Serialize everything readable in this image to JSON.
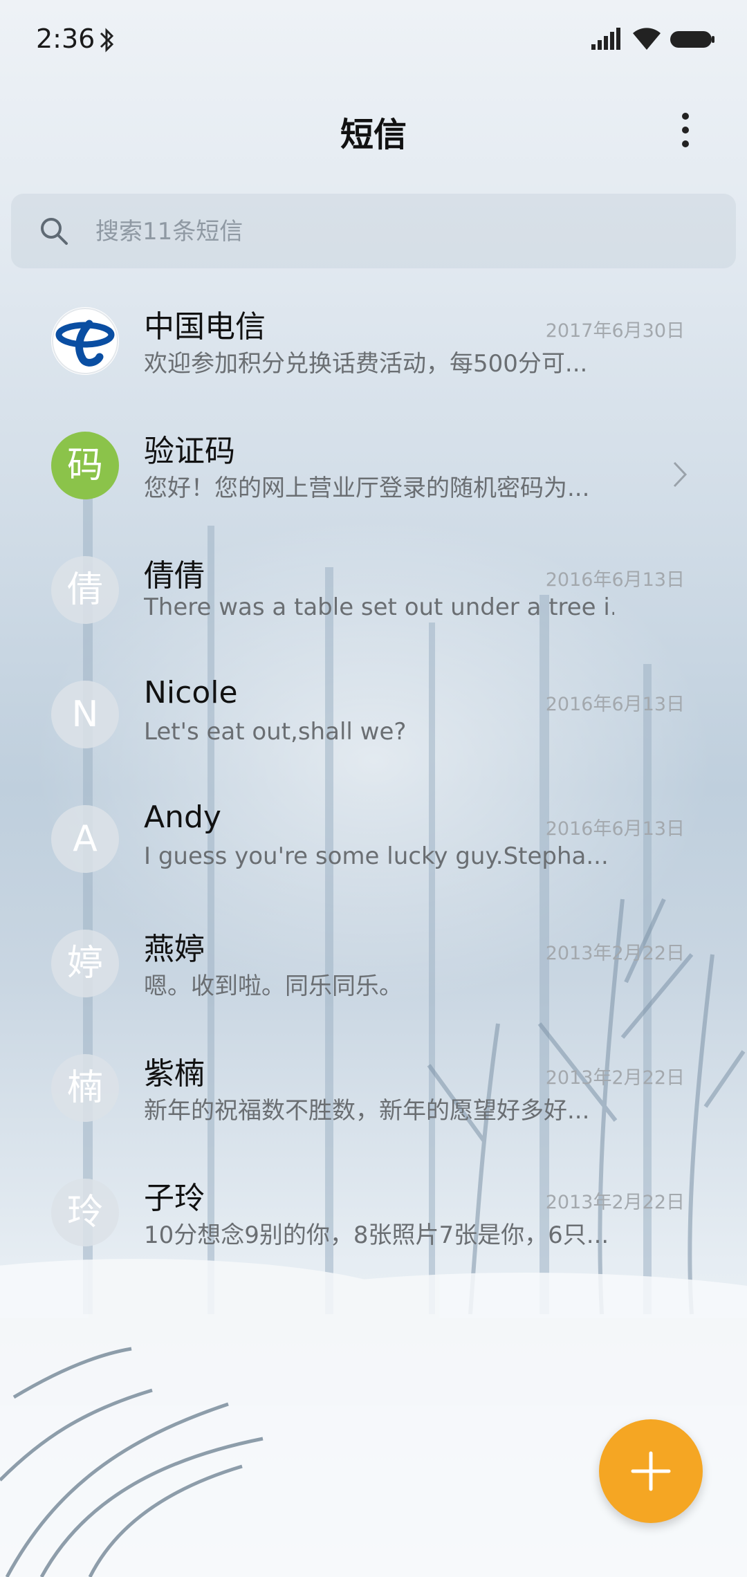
{
  "status_bar": {
    "time": "2:36"
  },
  "header": {
    "title": "短信"
  },
  "search": {
    "placeholder": "搜索11条短信"
  },
  "conversations": [
    {
      "avatar": "",
      "avatar_icon": "china-telecom-logo",
      "name": "中国电信",
      "preview": "欢迎参加积分兑换话费活动，每500分可...",
      "date": "2017年6月30日"
    },
    {
      "avatar": "码",
      "avatar_color": "#8bc34a",
      "name": "验证码",
      "preview": "您好！您的网上营业厅登录的随机密码为...",
      "date": ""
    },
    {
      "avatar": "倩",
      "name": "倩倩",
      "preview": "There was a table set out under a tree i...",
      "date": "2016年6月13日"
    },
    {
      "avatar": "N",
      "name": "Nicole",
      "preview": "Let's eat out,shall we?",
      "date": "2016年6月13日"
    },
    {
      "avatar": "A",
      "name": "Andy",
      "preview": "I guess you're some lucky guy.Stepha...",
      "date": "2016年6月13日"
    },
    {
      "avatar": "婷",
      "name": "燕婷",
      "preview": "嗯。收到啦。同乐同乐。",
      "date": "2013年2月22日"
    },
    {
      "avatar": "楠",
      "name": "紫楠",
      "preview": "新年的祝福数不胜数，新年的愿望好多好...",
      "date": "2013年2月22日"
    },
    {
      "avatar": "玲",
      "name": "子玲",
      "preview": "10分想念9别的你，8张照片7张是你，6只...",
      "date": "2013年2月22日"
    }
  ],
  "colors": {
    "fab": "#f5a623",
    "verify_avatar": "#8bc34a",
    "telecom_blue": "#0a4ea2"
  }
}
